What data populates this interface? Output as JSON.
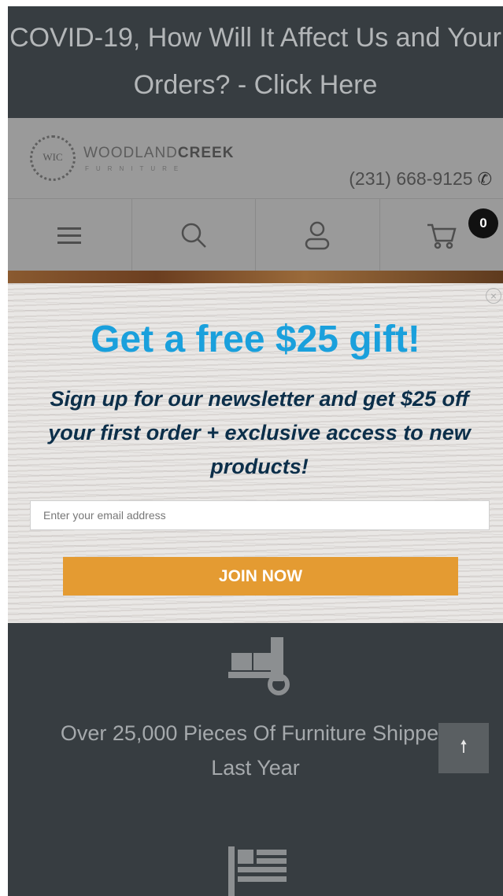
{
  "announcement": {
    "text": "COVID-19, How Will It Affect Us and Your Orders? - Click Here"
  },
  "header": {
    "logo_mark": "WIC",
    "brand_light": "WOODLAND",
    "brand_bold": "CREEK",
    "brand_tagline": "FURNITURE",
    "phone": "(231) 668-9125",
    "phone_icon": "phone-icon"
  },
  "nav": {
    "menu_icon": "hamburger-menu-icon",
    "search_icon": "search-icon",
    "account_icon": "user-icon",
    "cart_icon": "cart-icon",
    "cart_count": "0"
  },
  "popup": {
    "close_icon": "close-icon",
    "headline": "Get a free $25 gift!",
    "body": "Sign up for our newsletter and get $25 off your first order + exclusive access to new products!",
    "email": {
      "value": "",
      "placeholder": "Enter your email address"
    },
    "button_label": "JOIN NOW",
    "colors": {
      "headline": "#1aa0dc",
      "body": "#0c2f4a",
      "button": "#e49b32"
    }
  },
  "features": {
    "shipping_icon": "hand-truck-icon",
    "shipping_text": "Over 25,000 Pieces Of Furniture Shipped Last Year",
    "scroll_top_icon": "arrow-up-icon",
    "flag_icon": "flag-icon"
  },
  "colors": {
    "dark_background": "#373d41",
    "overlay_header": "#9a9a9a"
  }
}
